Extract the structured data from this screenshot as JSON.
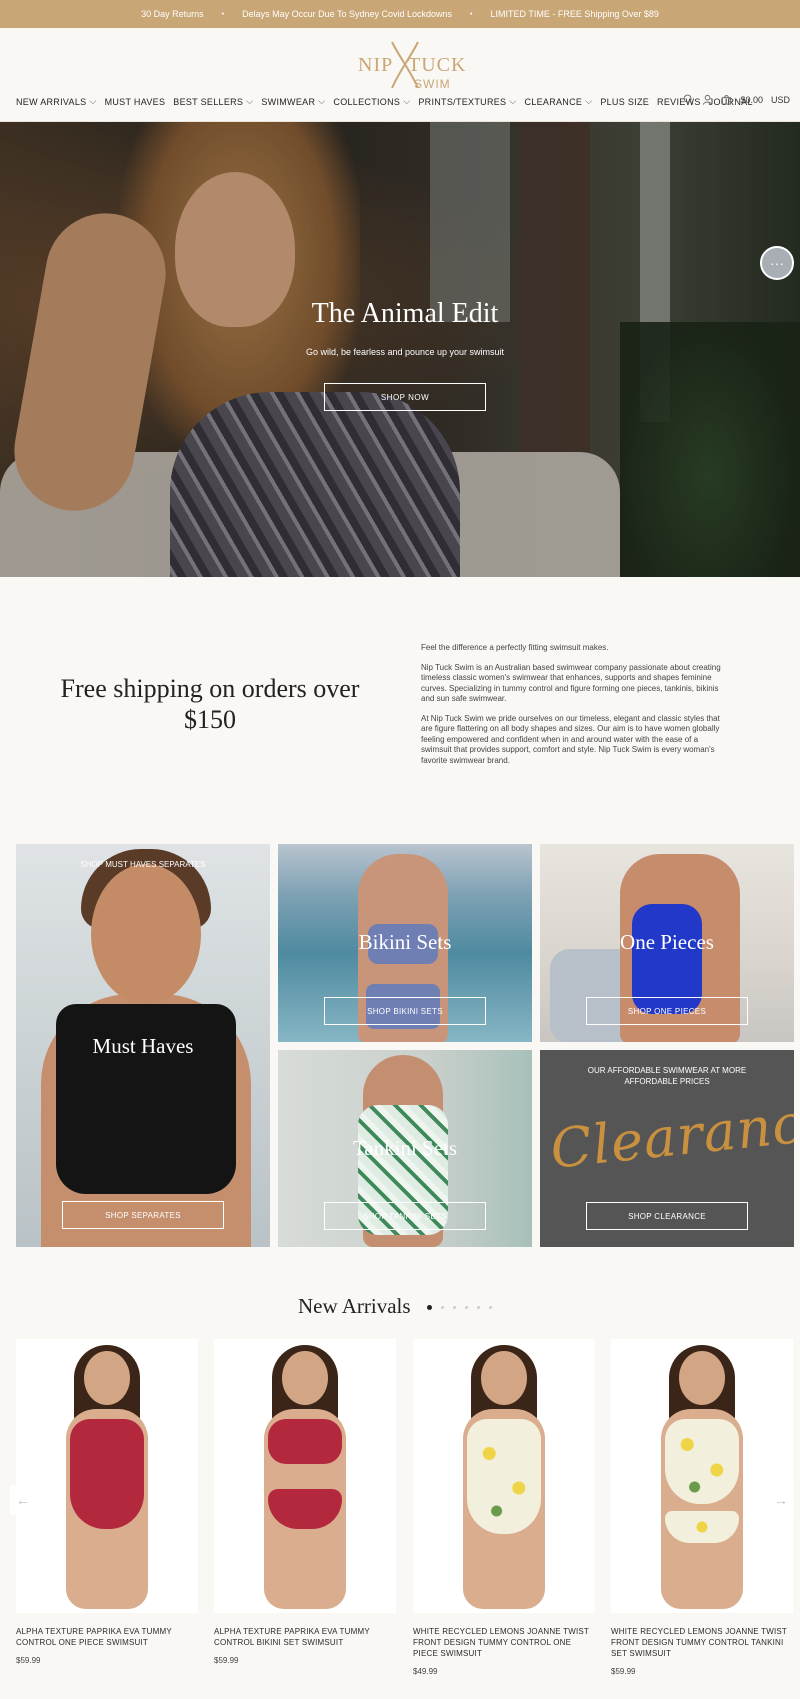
{
  "announcement": {
    "items": [
      "30 Day Returns",
      "Delays May Occur Due To Sydney Covid Lockdowns",
      "LIMITED TIME - FREE Shipping Over $89"
    ],
    "separator": "•"
  },
  "brand": {
    "part1": "NIP",
    "part2": "TUCK",
    "part3": "SWIM",
    "color": "#c9a676"
  },
  "nav": {
    "items": [
      "NEW ARRIVALS",
      "MUST HAVES",
      "BEST SELLERS",
      "SWIMWEAR",
      "COLLECTIONS",
      "PRINTS/TEXTURES",
      "CLEARANCE",
      "PLUS SIZE",
      "REVIEWS",
      "JOURNAL"
    ],
    "chevron": "⌵",
    "cart_total": "$0.00",
    "currency": "USD"
  },
  "hero": {
    "title": "The Animal Edit",
    "subtitle": "Go wild, be fearless and pounce up your swimsuit",
    "button": "SHOP NOW"
  },
  "chat": {
    "icon": "chat-bubble-icon",
    "glyph": "···"
  },
  "intro": {
    "heading": "Free shipping on orders over $150",
    "paragraphs": [
      "Feel the difference a perfectly fitting swimsuit makes.",
      "Nip Tuck Swim is an Australian based swimwear company passionate about creating timeless classic women's swimwear that enhances, supports and shapes feminine curves. Specializing in tummy control and figure forming one pieces, tankinis, bikinis and sun safe swimwear.",
      "At Nip Tuck Swim we pride ourselves on our timeless, elegant and classic styles that are figure flattering on all body shapes and sizes.  Our aim is to have women globally feeling empowered and confident when in and around water with the ease of a swimsuit that provides support, comfort and style. Nip Tuck Swim is every woman's favorite swimwear brand."
    ]
  },
  "categories": {
    "must": {
      "caption": "SHOP MUST HAVES SEPARATES",
      "label": "Must Haves",
      "button": "SHOP SEPARATES"
    },
    "bikini": {
      "label": "Bikini Sets",
      "button": "SHOP BIKINI SETS"
    },
    "one": {
      "label": "One Pieces",
      "button": "SHOP ONE PIECES"
    },
    "tankini": {
      "label": "Tankini Sets",
      "button": "SHOP TANKINI SETS"
    },
    "clearance": {
      "caption": "OUR AFFORDABLE SWIMWEAR AT MORE AFFORDABLE PRICES",
      "script": "Clearance",
      "button": "SHOP CLEARANCE"
    }
  },
  "new_arrivals": {
    "title": "New Arrivals",
    "products": [
      {
        "name": "ALPHA TEXTURE PAPRIKA EVA TUMMY CONTROL ONE PIECE SWIMSUIT",
        "price": "$59.99",
        "suit_color": "#b3283d"
      },
      {
        "name": "ALPHA TEXTURE PAPRIKA EVA TUMMY CONTROL BIKINI SET SWIMSUIT",
        "price": "$59.99",
        "suit_color": "#b3283d"
      },
      {
        "name": "WHITE RECYCLED LEMONS JOANNE TWIST FRONT DESIGN TUMMY CONTROL ONE PIECE SWIMSUIT",
        "price": "$49.99",
        "suit_color": "#e8e6b0"
      },
      {
        "name": "WHITE RECYCLED LEMONS JOANNE TWIST FRONT DESIGN TUMMY CONTROL TANKINI SET SWIMSUIT",
        "price": "$59.99",
        "suit_color": "#e8e6b0"
      }
    ],
    "prev_arrow": "←",
    "next_arrow": "→"
  },
  "colors": {
    "accent": "#c9a676",
    "background": "#faf8f4",
    "clearance_script": "#c9913f"
  }
}
